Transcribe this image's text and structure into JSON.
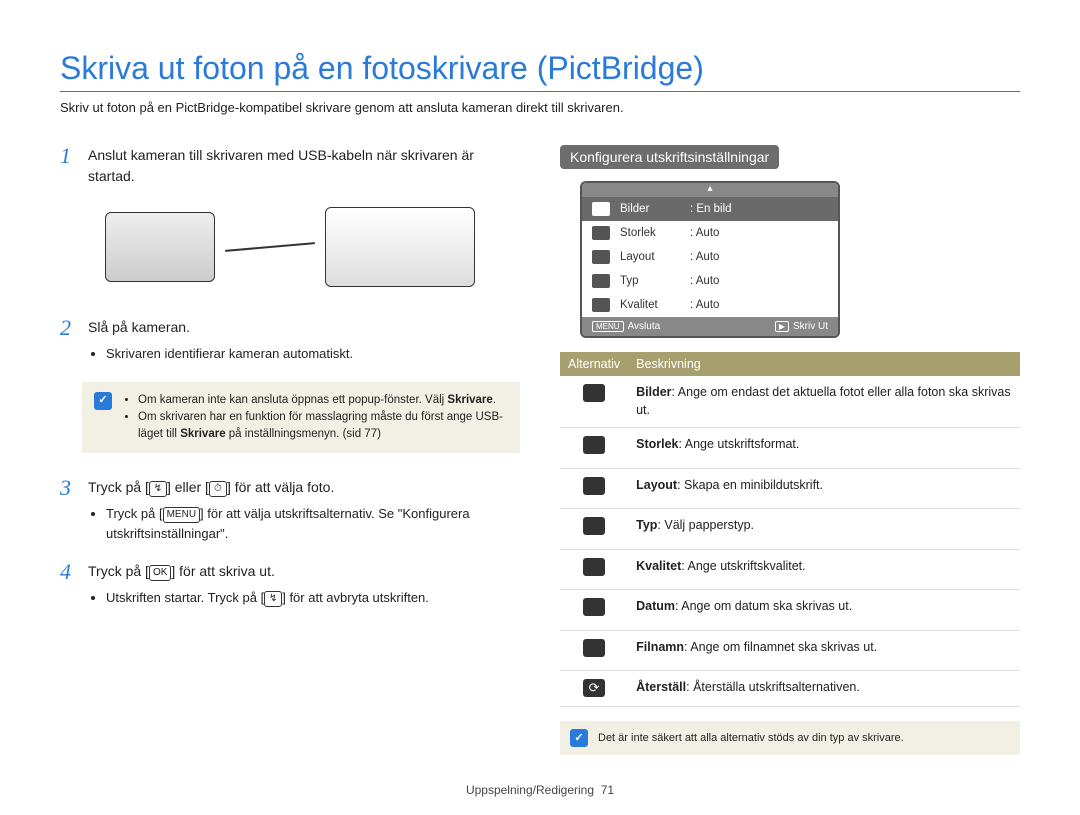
{
  "title": "Skriva ut foton på en fotoskrivare (PictBridge)",
  "subtitle": "Skriv ut foton på en PictBridge-kompatibel skrivare genom att ansluta kameran direkt till skrivaren.",
  "steps": {
    "s1": {
      "num": "1",
      "text": "Anslut kameran till skrivaren med USB-kabeln när skrivaren är startad."
    },
    "s2": {
      "num": "2",
      "text": "Slå på kameran.",
      "bullet": "Skrivaren identifierar kameran automatiskt."
    },
    "s3": {
      "num": "3",
      "pre": "Tryck på [",
      "icon1": "↯",
      "mid": "] eller [",
      "icon2": "⏱",
      "post": "] för att välja foto.",
      "bullet_pre": "Tryck på [",
      "bullet_icon": "MENU",
      "bullet_post": "] för att välja utskriftsalternativ. Se \"Konfigurera utskriftsinställningar\"."
    },
    "s4": {
      "num": "4",
      "pre": "Tryck på [",
      "icon": "OK",
      "post": "] för att skriva ut.",
      "bullet_pre": "Utskriften startar. Tryck på [",
      "bullet_icon": "↯",
      "bullet_post": "] för att avbryta utskriften."
    }
  },
  "notes": {
    "n1a_pre": "Om kameran inte kan ansluta öppnas ett popup-fönster. Välj ",
    "n1a_bold": "Skrivare",
    "n1a_post": ".",
    "n1b_pre": "Om skrivaren har en funktion för masslagring måste du först ange USB-läget till ",
    "n1b_bold": "Skrivare",
    "n1b_post": " på inställningsmenyn. (sid 77)",
    "n2": "Det är inte säkert att alla alternativ stöds av din typ av skrivare."
  },
  "right": {
    "section": "Konfigurera utskriftsinställningar",
    "lcd": {
      "rows": [
        {
          "label": "Bilder",
          "value": "En bild",
          "active": true
        },
        {
          "label": "Storlek",
          "value": "Auto"
        },
        {
          "label": "Layout",
          "value": "Auto"
        },
        {
          "label": "Typ",
          "value": "Auto"
        },
        {
          "label": "Kvalitet",
          "value": "Auto"
        }
      ],
      "footer_left_key": "MENU",
      "footer_left": "Avsluta",
      "footer_right_key": "▶",
      "footer_right": "Skriv Ut"
    },
    "table_headers": {
      "c1": "Alternativ",
      "c2": "Beskrivning"
    },
    "options": [
      {
        "name": "Bilder",
        "desc": ": Ange om endast det aktuella fotot eller alla foton ska skrivas ut."
      },
      {
        "name": "Storlek",
        "desc": ": Ange utskriftsformat."
      },
      {
        "name": "Layout",
        "desc": ": Skapa en minibildutskrift."
      },
      {
        "name": "Typ",
        "desc": ": Välj papperstyp."
      },
      {
        "name": "Kvalitet",
        "desc": ": Ange utskriftskvalitet."
      },
      {
        "name": "Datum",
        "desc": ": Ange om datum ska skrivas ut."
      },
      {
        "name": "Filnamn",
        "desc": ": Ange om filnamnet ska skrivas ut."
      },
      {
        "name": "Återställ",
        "desc": ": Återställa utskriftsalternativen.",
        "swap": true
      }
    ]
  },
  "footer": {
    "section": "Uppspelning/Redigering",
    "page": "71"
  }
}
